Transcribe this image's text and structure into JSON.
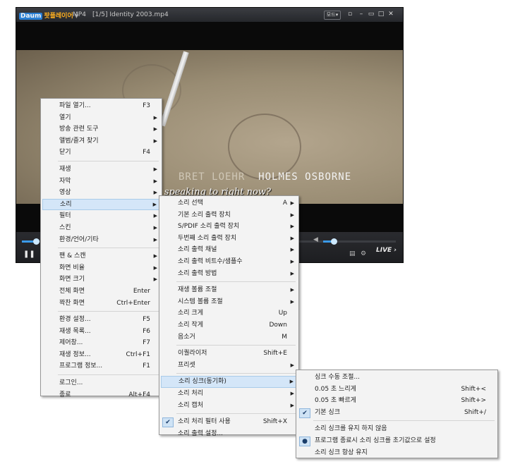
{
  "player": {
    "logo_daum": "Daum",
    "logo_title": "팟플레이어",
    "format": "MP4",
    "file_title": "[1/5] Identity 2003.mp4",
    "mode_label": "모드",
    "credit_left": "BRET LOEHR",
    "credit_right": "HOLMES OSBORNE",
    "subtitle": "n I speaking to right now?",
    "live_label": "LIVE"
  },
  "main_menu": [
    {
      "label": "파일 열기...",
      "shortcut": "F3"
    },
    {
      "label": "열기",
      "submenu": true
    },
    {
      "label": "방송 관련 도구",
      "submenu": true
    },
    {
      "label": "앨범/즐겨 찾기",
      "submenu": true
    },
    {
      "label": "닫기",
      "shortcut": "F4"
    },
    {
      "sep": true
    },
    {
      "label": "재생",
      "submenu": true
    },
    {
      "label": "자막",
      "submenu": true
    },
    {
      "label": "영상",
      "submenu": true
    },
    {
      "label": "소리",
      "submenu": true,
      "highlight": true
    },
    {
      "label": "필터",
      "submenu": true
    },
    {
      "label": "스킨",
      "submenu": true
    },
    {
      "label": "환경/언어/기타",
      "submenu": true
    },
    {
      "sep": true
    },
    {
      "label": "팬 & 스캔",
      "submenu": true
    },
    {
      "label": "화면 비율",
      "submenu": true
    },
    {
      "label": "화면 크기",
      "submenu": true
    },
    {
      "label": "전체 화면",
      "shortcut": "Enter"
    },
    {
      "label": "꽉찬 화면",
      "shortcut": "Ctrl+Enter"
    },
    {
      "sep": true
    },
    {
      "label": "환경 설정...",
      "shortcut": "F5"
    },
    {
      "label": "재생 목록...",
      "shortcut": "F6"
    },
    {
      "label": "제어창...",
      "shortcut": "F7"
    },
    {
      "label": "재생 정보...",
      "shortcut": "Ctrl+F1"
    },
    {
      "label": "프로그램 정보...",
      "shortcut": "F1"
    },
    {
      "sep": true
    },
    {
      "label": "로그인..."
    },
    {
      "label": "종료",
      "shortcut": "Alt+F4"
    }
  ],
  "sound_menu": [
    {
      "label": "소리 선택",
      "shortcut": "A",
      "submenu": true
    },
    {
      "label": "기본 소리 출력 장치",
      "submenu": true
    },
    {
      "label": "S/PDIF 소리 출력 장치",
      "submenu": true
    },
    {
      "label": "두번째 소리 출력 장치",
      "submenu": true
    },
    {
      "label": "소리 출력 채널",
      "submenu": true
    },
    {
      "label": "소리 출력 비트수/샘플수",
      "submenu": true
    },
    {
      "label": "소리 출력 방법",
      "submenu": true
    },
    {
      "sep": true
    },
    {
      "label": "재생 볼륨 조절",
      "submenu": true
    },
    {
      "label": "시스템 볼륨 조절",
      "submenu": true
    },
    {
      "label": "소리 크게",
      "shortcut": "Up"
    },
    {
      "label": "소리 작게",
      "shortcut": "Down"
    },
    {
      "label": "음소거",
      "shortcut": "M"
    },
    {
      "sep": true
    },
    {
      "label": "이퀄라이저",
      "shortcut": "Shift+E"
    },
    {
      "label": "프리셋",
      "submenu": true
    },
    {
      "sep": true
    },
    {
      "label": "소리 싱크(동기화)",
      "submenu": true,
      "highlight": true
    },
    {
      "label": "소리 처리",
      "submenu": true
    },
    {
      "label": "소리 캡처",
      "submenu": true
    },
    {
      "sep": true
    },
    {
      "label": "소리 처리 필터 사용",
      "shortcut": "Shift+X",
      "check": "✔"
    },
    {
      "label": "소리 출력 설정..."
    }
  ],
  "sync_menu": [
    {
      "label": "싱크 수동 조절..."
    },
    {
      "label": "0.05 초 느리게",
      "shortcut": "Shift+<"
    },
    {
      "label": "0.05 초 빠르게",
      "shortcut": "Shift+>"
    },
    {
      "label": "기본 싱크",
      "shortcut": "Shift+/",
      "check": "✔"
    },
    {
      "sep": true
    },
    {
      "label": "소리 싱크를 유지 하지 않음"
    },
    {
      "label": "프로그램 종료시 소리 싱크를 초기값으로 설정",
      "check": "●"
    },
    {
      "label": "소리 싱크 항상 유지"
    }
  ]
}
